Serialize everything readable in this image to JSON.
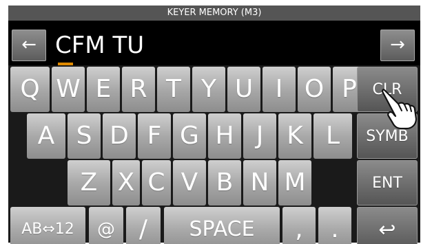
{
  "title": "KEYER MEMORY  (M3)",
  "input": {
    "value": "CFM TU"
  },
  "nav": {
    "left": "←",
    "right": "→"
  },
  "rows": [
    [
      "Q",
      "W",
      "E",
      "R",
      "T",
      "Y",
      "U",
      "I",
      "O",
      "P"
    ],
    [
      "A",
      "S",
      "D",
      "F",
      "G",
      "H",
      "J",
      "K",
      "L"
    ],
    [
      "Z",
      "X",
      "C",
      "V",
      "B",
      "N",
      "M"
    ]
  ],
  "bottom": {
    "mode": "AB⇔12",
    "at": "@",
    "slash": "/",
    "space": "SPACE",
    "comma": ",",
    "period": "."
  },
  "side": {
    "clr": "CLR",
    "symb": "SYMB",
    "ent": "ENT",
    "back": "↩"
  }
}
